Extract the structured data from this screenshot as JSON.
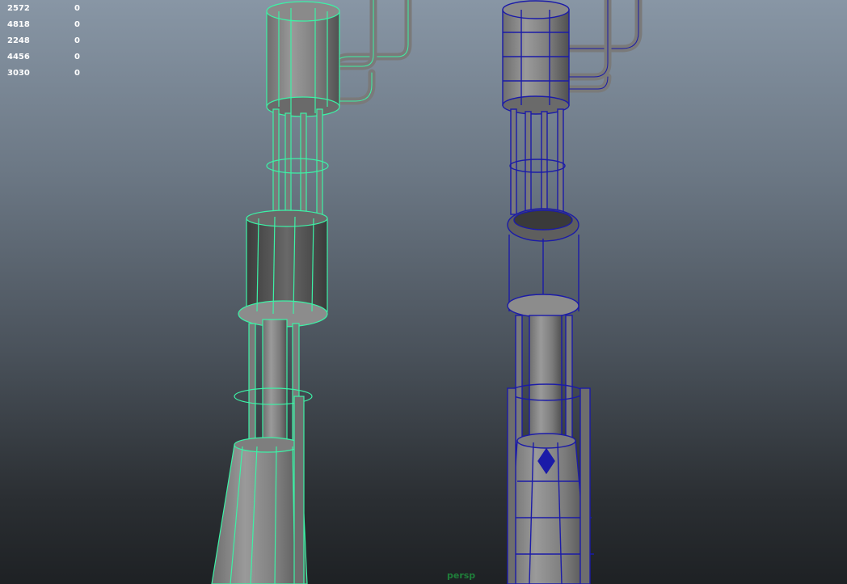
{
  "hud": {
    "rows": [
      {
        "value": "2572",
        "zero": "0"
      },
      {
        "value": "4818",
        "zero": "0"
      },
      {
        "value": "2248",
        "zero": "0"
      },
      {
        "value": "4456",
        "zero": "0"
      },
      {
        "value": "3030",
        "zero": "0"
      }
    ]
  },
  "camera": {
    "label": "persp"
  },
  "colors": {
    "selected_wire": "#3cf2a6",
    "wire_blue": "#1b1ba8",
    "metal": "#8c8c8c",
    "metal_dark": "#555555"
  }
}
